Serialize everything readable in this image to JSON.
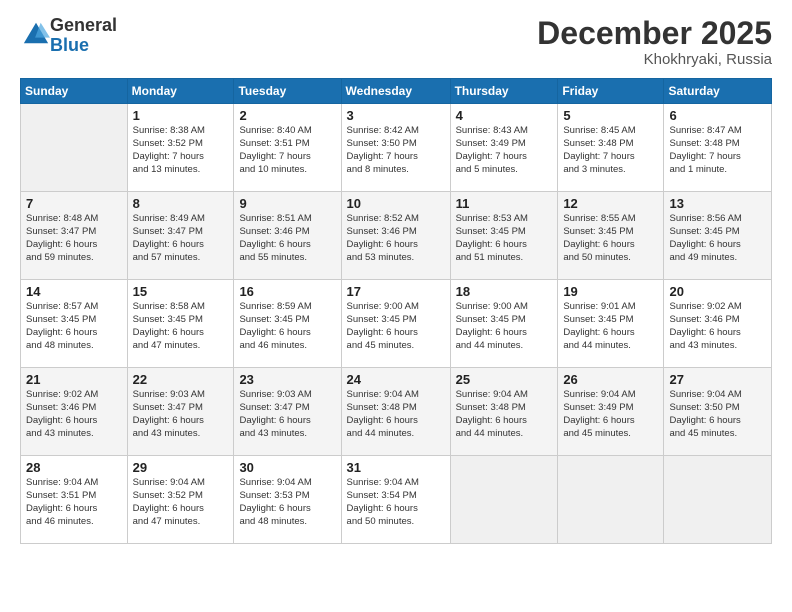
{
  "header": {
    "logo_general": "General",
    "logo_blue": "Blue",
    "month_year": "December 2025",
    "location": "Khokhryaki, Russia"
  },
  "weekdays": [
    "Sunday",
    "Monday",
    "Tuesday",
    "Wednesday",
    "Thursday",
    "Friday",
    "Saturday"
  ],
  "weeks": [
    [
      {
        "date": "",
        "info": ""
      },
      {
        "date": "1",
        "info": "Sunrise: 8:38 AM\nSunset: 3:52 PM\nDaylight: 7 hours\nand 13 minutes."
      },
      {
        "date": "2",
        "info": "Sunrise: 8:40 AM\nSunset: 3:51 PM\nDaylight: 7 hours\nand 10 minutes."
      },
      {
        "date": "3",
        "info": "Sunrise: 8:42 AM\nSunset: 3:50 PM\nDaylight: 7 hours\nand 8 minutes."
      },
      {
        "date": "4",
        "info": "Sunrise: 8:43 AM\nSunset: 3:49 PM\nDaylight: 7 hours\nand 5 minutes."
      },
      {
        "date": "5",
        "info": "Sunrise: 8:45 AM\nSunset: 3:48 PM\nDaylight: 7 hours\nand 3 minutes."
      },
      {
        "date": "6",
        "info": "Sunrise: 8:47 AM\nSunset: 3:48 PM\nDaylight: 7 hours\nand 1 minute."
      }
    ],
    [
      {
        "date": "7",
        "info": "Sunrise: 8:48 AM\nSunset: 3:47 PM\nDaylight: 6 hours\nand 59 minutes."
      },
      {
        "date": "8",
        "info": "Sunrise: 8:49 AM\nSunset: 3:47 PM\nDaylight: 6 hours\nand 57 minutes."
      },
      {
        "date": "9",
        "info": "Sunrise: 8:51 AM\nSunset: 3:46 PM\nDaylight: 6 hours\nand 55 minutes."
      },
      {
        "date": "10",
        "info": "Sunrise: 8:52 AM\nSunset: 3:46 PM\nDaylight: 6 hours\nand 53 minutes."
      },
      {
        "date": "11",
        "info": "Sunrise: 8:53 AM\nSunset: 3:45 PM\nDaylight: 6 hours\nand 51 minutes."
      },
      {
        "date": "12",
        "info": "Sunrise: 8:55 AM\nSunset: 3:45 PM\nDaylight: 6 hours\nand 50 minutes."
      },
      {
        "date": "13",
        "info": "Sunrise: 8:56 AM\nSunset: 3:45 PM\nDaylight: 6 hours\nand 49 minutes."
      }
    ],
    [
      {
        "date": "14",
        "info": "Sunrise: 8:57 AM\nSunset: 3:45 PM\nDaylight: 6 hours\nand 48 minutes."
      },
      {
        "date": "15",
        "info": "Sunrise: 8:58 AM\nSunset: 3:45 PM\nDaylight: 6 hours\nand 47 minutes."
      },
      {
        "date": "16",
        "info": "Sunrise: 8:59 AM\nSunset: 3:45 PM\nDaylight: 6 hours\nand 46 minutes."
      },
      {
        "date": "17",
        "info": "Sunrise: 9:00 AM\nSunset: 3:45 PM\nDaylight: 6 hours\nand 45 minutes."
      },
      {
        "date": "18",
        "info": "Sunrise: 9:00 AM\nSunset: 3:45 PM\nDaylight: 6 hours\nand 44 minutes."
      },
      {
        "date": "19",
        "info": "Sunrise: 9:01 AM\nSunset: 3:45 PM\nDaylight: 6 hours\nand 44 minutes."
      },
      {
        "date": "20",
        "info": "Sunrise: 9:02 AM\nSunset: 3:46 PM\nDaylight: 6 hours\nand 43 minutes."
      }
    ],
    [
      {
        "date": "21",
        "info": "Sunrise: 9:02 AM\nSunset: 3:46 PM\nDaylight: 6 hours\nand 43 minutes."
      },
      {
        "date": "22",
        "info": "Sunrise: 9:03 AM\nSunset: 3:47 PM\nDaylight: 6 hours\nand 43 minutes."
      },
      {
        "date": "23",
        "info": "Sunrise: 9:03 AM\nSunset: 3:47 PM\nDaylight: 6 hours\nand 43 minutes."
      },
      {
        "date": "24",
        "info": "Sunrise: 9:04 AM\nSunset: 3:48 PM\nDaylight: 6 hours\nand 44 minutes."
      },
      {
        "date": "25",
        "info": "Sunrise: 9:04 AM\nSunset: 3:48 PM\nDaylight: 6 hours\nand 44 minutes."
      },
      {
        "date": "26",
        "info": "Sunrise: 9:04 AM\nSunset: 3:49 PM\nDaylight: 6 hours\nand 45 minutes."
      },
      {
        "date": "27",
        "info": "Sunrise: 9:04 AM\nSunset: 3:50 PM\nDaylight: 6 hours\nand 45 minutes."
      }
    ],
    [
      {
        "date": "28",
        "info": "Sunrise: 9:04 AM\nSunset: 3:51 PM\nDaylight: 6 hours\nand 46 minutes."
      },
      {
        "date": "29",
        "info": "Sunrise: 9:04 AM\nSunset: 3:52 PM\nDaylight: 6 hours\nand 47 minutes."
      },
      {
        "date": "30",
        "info": "Sunrise: 9:04 AM\nSunset: 3:53 PM\nDaylight: 6 hours\nand 48 minutes."
      },
      {
        "date": "31",
        "info": "Sunrise: 9:04 AM\nSunset: 3:54 PM\nDaylight: 6 hours\nand 50 minutes."
      },
      {
        "date": "",
        "info": ""
      },
      {
        "date": "",
        "info": ""
      },
      {
        "date": "",
        "info": ""
      }
    ]
  ]
}
